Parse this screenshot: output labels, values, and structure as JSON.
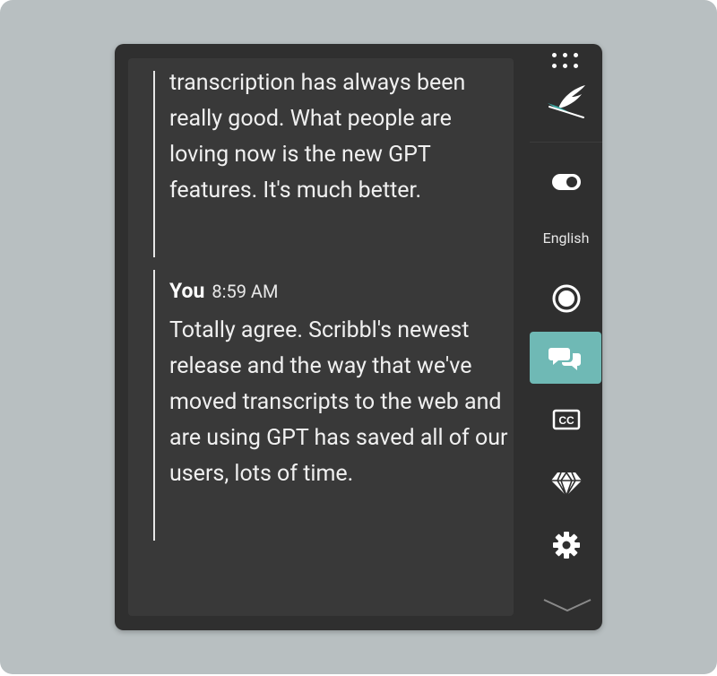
{
  "transcript": {
    "messages": [
      {
        "text": "transcription has always been really good. What people are loving now is the new GPT features. It's much better."
      },
      {
        "speaker": "You",
        "time": "8:59 AM",
        "text": "Totally agree. Scribbl's newest release and the way that we've moved transcripts to the web and are using GPT has saved all of our users, lots of time."
      }
    ]
  },
  "sidebar": {
    "language": "English",
    "icons": {
      "grip": "grip-dots-icon",
      "logo": "quill-logo-icon",
      "toggle": "toggle-icon",
      "record": "record-icon",
      "chat": "chat-bubbles-icon",
      "captions": "closed-captions-icon",
      "premium": "diamond-icon",
      "settings": "gear-icon",
      "collapse": "chevron-down-icon"
    }
  },
  "colors": {
    "accent": "#6fb9b5",
    "panel": "#2f2f2f",
    "transcript_bg": "#393939",
    "backdrop": "#b8bfc1"
  }
}
